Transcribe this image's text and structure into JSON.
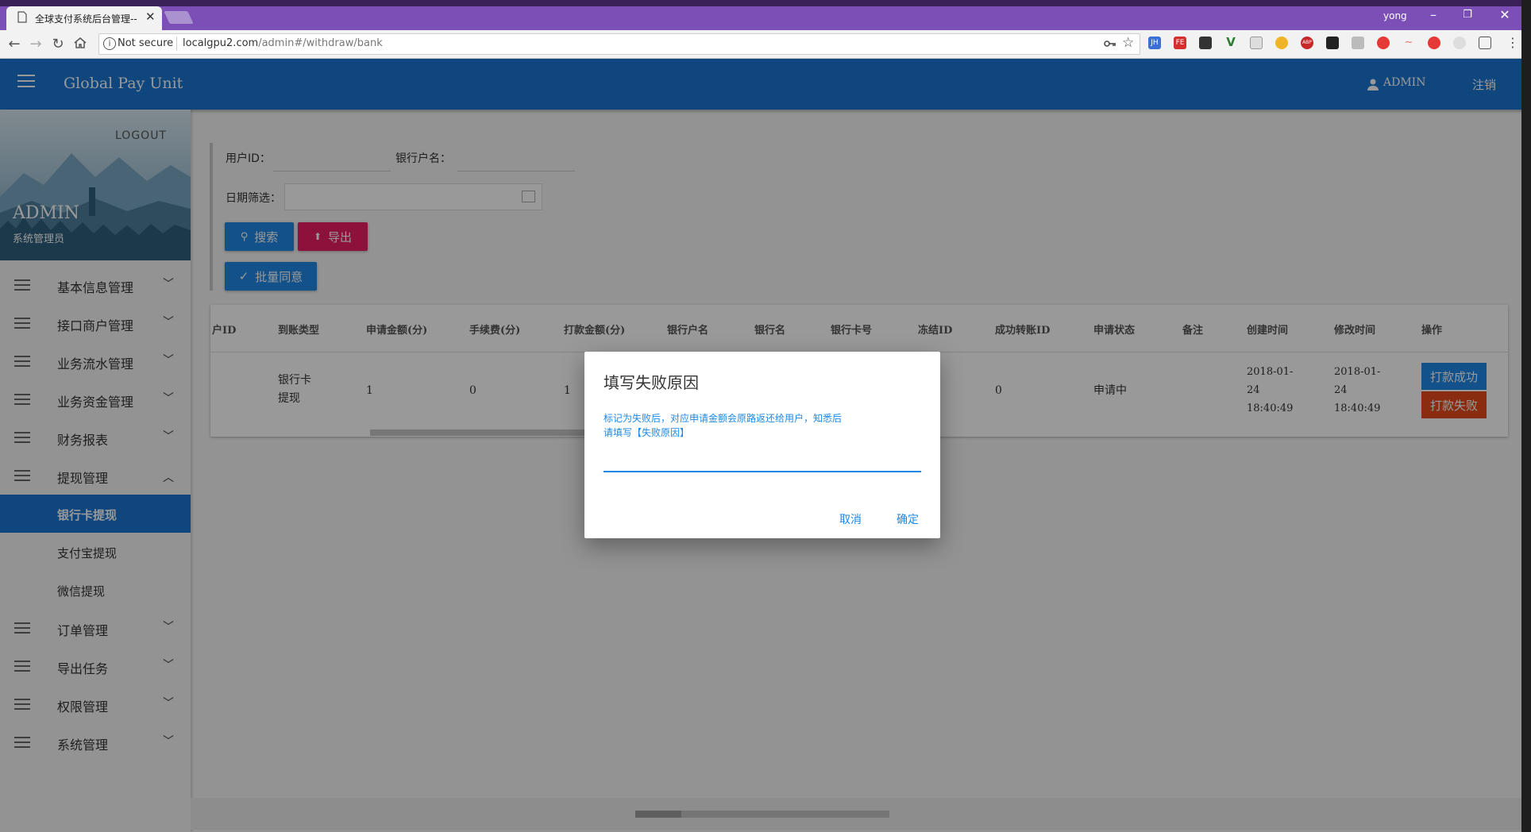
{
  "browser": {
    "tab_title": "全球支付系统后台管理--",
    "profile_name": "yong",
    "security_label": "Not secure",
    "url_host": "localgpu2.com",
    "url_path": "/admin#/withdraw/bank",
    "extensions": [
      "JH",
      "FE",
      "ABP"
    ]
  },
  "header": {
    "brand": "Global Pay Unit",
    "user": "ADMIN",
    "logout": "注销"
  },
  "profile": {
    "logout": "LOGOUT",
    "name": "ADMIN",
    "role": "系统管理员"
  },
  "sidebar": {
    "items": [
      {
        "label": "基本信息管理"
      },
      {
        "label": "接口商户管理"
      },
      {
        "label": "业务流水管理"
      },
      {
        "label": "业务资金管理"
      },
      {
        "label": "财务报表"
      },
      {
        "label": "提现管理"
      },
      {
        "label": "订单管理"
      },
      {
        "label": "导出任务"
      },
      {
        "label": "权限管理"
      },
      {
        "label": "系统管理"
      }
    ],
    "subitems": [
      {
        "label": "银行卡提现",
        "active": true
      },
      {
        "label": "支付宝提现"
      },
      {
        "label": "微信提现"
      }
    ]
  },
  "filters": {
    "user_id_label": "用户ID：",
    "bank_name_label": "银行户名：",
    "date_label": "日期筛选：",
    "search_button": "搜索",
    "export_button": "导出",
    "batch_approve_button": "批量同意"
  },
  "table": {
    "columns": [
      "户ID",
      "到账类型",
      "申请金额(分)",
      "手续费(分)",
      "打款金额(分)",
      "银行户名",
      "银行名",
      "银行卡号",
      "冻结ID",
      "成功转账ID",
      "申请状态",
      "备注",
      "创建时间",
      "修改时间",
      "操作"
    ],
    "row": {
      "type_line1": "银行卡",
      "type_line2": "提现",
      "amount": "1",
      "fee": "0",
      "paid": "1",
      "success_id": "0",
      "status": "申请中",
      "created_date": "2018-01-",
      "created_day": "24",
      "created_time": "18:40:49",
      "modified_date": "2018-01-",
      "modified_day": "24",
      "modified_time": "18:40:49"
    },
    "pay_success": "打款成功",
    "pay_fail": "打款失败"
  },
  "dialog": {
    "title": "填写失败原因",
    "hint_line1": "标记为失败后，对应申请金额会原路返还给用户，知悉后",
    "hint_line2": "请填写【失败原因】",
    "input_value": "",
    "cancel": "取消",
    "confirm": "确定"
  },
  "colors": {
    "primary": "#1976d2",
    "accent_pink": "#e91e63",
    "danger": "#e64a19",
    "browser_frame": "#7b4fb5"
  }
}
